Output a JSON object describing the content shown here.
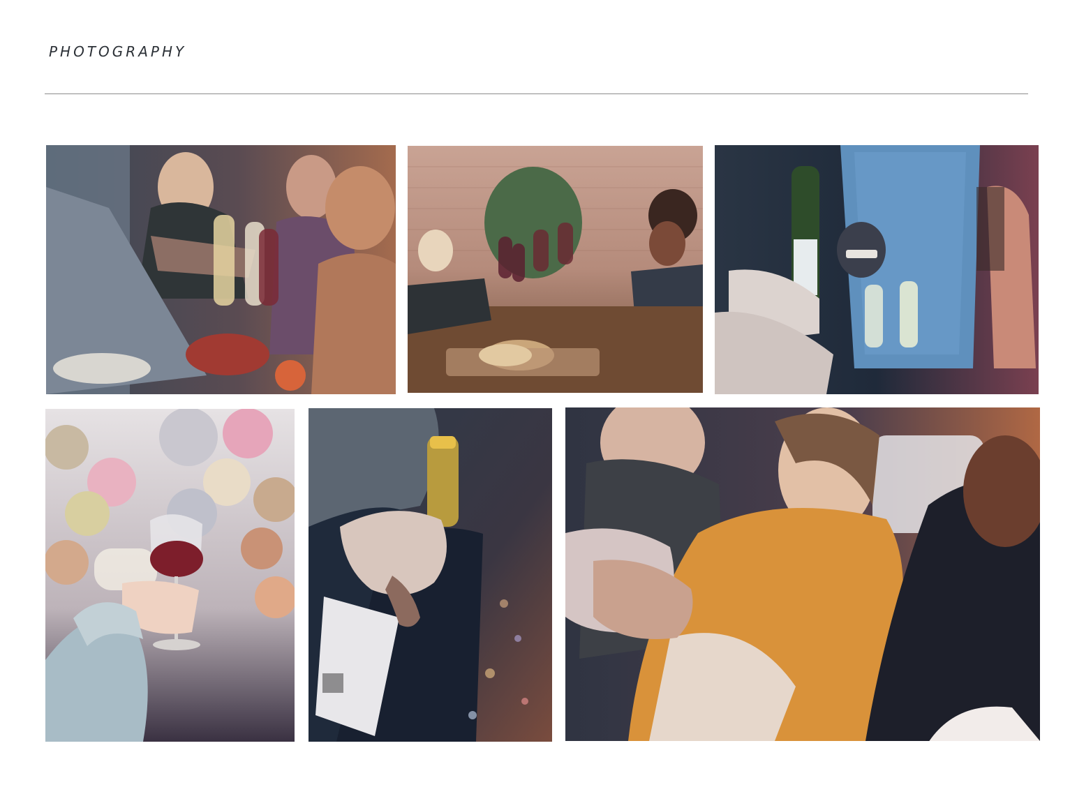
{
  "page": {
    "title": "PHOTOGRAPHY"
  },
  "colors": {
    "title": "#2b3036",
    "divider": "#8c8c8c",
    "background": "#ffffff"
  },
  "photos": [
    {
      "icon": "toast-friends-photo"
    },
    {
      "icon": "dinner-table-toast-photo"
    },
    {
      "icon": "party-wine-pour-photo"
    },
    {
      "icon": "balloons-wine-glass-photo"
    },
    {
      "icon": "wine-bottle-hand-photo"
    },
    {
      "icon": "laughing-friends-photo"
    }
  ]
}
